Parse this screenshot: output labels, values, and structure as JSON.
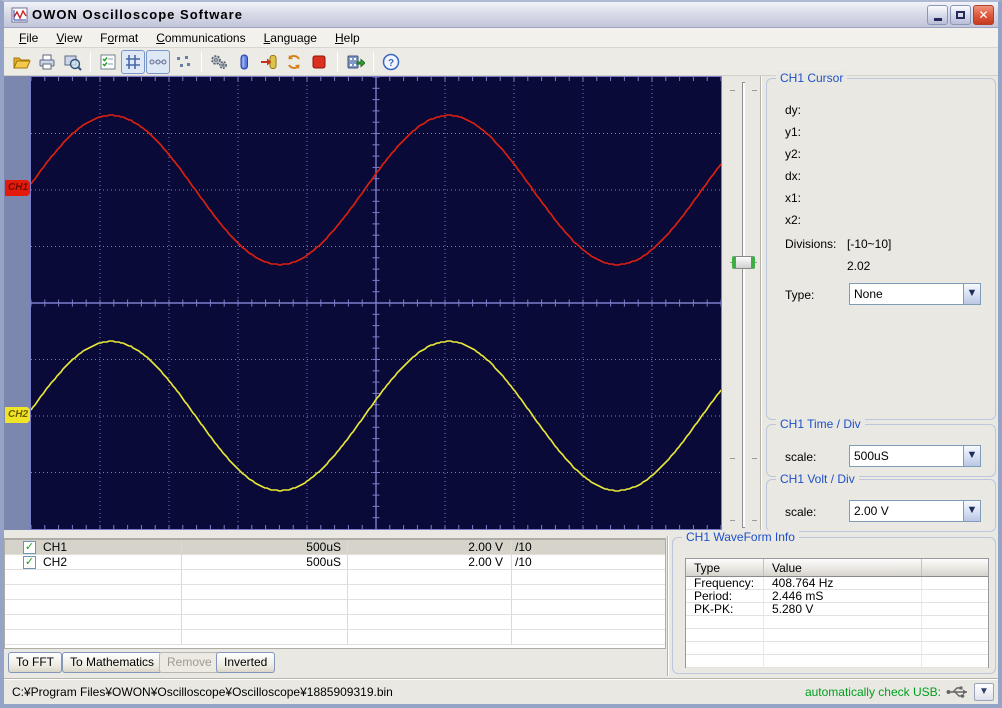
{
  "window": {
    "title": "OWON Oscilloscope Software"
  },
  "menu": {
    "items": [
      {
        "pre": "",
        "accel": "F",
        "post": "ile"
      },
      {
        "pre": "",
        "accel": "V",
        "post": "iew"
      },
      {
        "pre": "F",
        "accel": "o",
        "post": "rmat"
      },
      {
        "pre": "",
        "accel": "C",
        "post": "ommunications"
      },
      {
        "pre": "",
        "accel": "L",
        "post": "anguage"
      },
      {
        "pre": "",
        "accel": "H",
        "post": "elp"
      }
    ]
  },
  "toolbar": {
    "icons": [
      "open-folder",
      "print",
      "print-preview",
      "channel-list",
      "grid-display",
      "dot-line-display",
      "dots-display",
      "settings-gears",
      "battery",
      "exit-connect",
      "refresh",
      "stop",
      "export-record",
      "help"
    ],
    "active_icons": [
      "grid-display",
      "dot-line-display"
    ]
  },
  "plot": {
    "markers": [
      {
        "label": "CH1"
      },
      {
        "label": "CH2"
      }
    ]
  },
  "cursor_panel": {
    "title": "CH1 Cursor",
    "fields": [
      "dy:",
      "y1:",
      "y2:",
      "dx:",
      "x1:",
      "x2:"
    ],
    "divisions_label": "Divisions:",
    "divisions_value": "[-10~10]",
    "divisions_value2": "2.02",
    "type_label": "Type:",
    "type_value": "None"
  },
  "time_div": {
    "title": "CH1 Time / Div",
    "scale_label": "scale:",
    "value": "500uS"
  },
  "volt_div": {
    "title": "CH1 Volt / Div",
    "scale_label": "scale:",
    "value": "2.00 V"
  },
  "channels_table": {
    "rows": [
      {
        "name": "CH1",
        "time": "500uS",
        "volt": "2.00 V",
        "probe": "/10",
        "checked": true,
        "selected": true
      },
      {
        "name": "CH2",
        "time": "500uS",
        "volt": "2.00 V",
        "probe": "/10",
        "checked": true,
        "selected": false
      }
    ]
  },
  "action_buttons": [
    {
      "label": "To FFT",
      "enabled": true
    },
    {
      "label": "To Mathematics",
      "enabled": true
    },
    {
      "label": "Remove",
      "enabled": false
    },
    {
      "label": "Inverted",
      "enabled": true
    }
  ],
  "waveform_info": {
    "title": "CH1 WaveForm Info",
    "columns": [
      "Type",
      "Value"
    ],
    "rows": [
      [
        "Frequency:",
        "408.764 Hz"
      ],
      [
        "Period:",
        "2.446 mS"
      ],
      [
        "PK-PK:",
        "5.280 V"
      ]
    ]
  },
  "statusbar": {
    "file_path": "C:¥Program Files¥OWON¥Oscilloscope¥Oscilloscope¥1885909319.bin",
    "usb_label": "automatically check  USB:"
  },
  "colors": {
    "plot_bg": "#0a0a38",
    "grid": "#7c7cca",
    "ch1": "#dd2010",
    "ch2": "#e8e838",
    "accent_title": "#2050c8",
    "status_green": "#00a020",
    "marker_ch1": "#e41b0c",
    "marker_ch2": "#f0e428"
  },
  "chart_data": {
    "type": "line",
    "title": "Oscilloscope display CH1/CH2",
    "x_divisions": 10,
    "y_divisions": 8,
    "time_per_div": "500uS",
    "volt_per_div": "2.00 V",
    "series": [
      {
        "name": "CH1",
        "color": "#dd2010",
        "center_div": 2.0,
        "amplitude_div": 1.32,
        "period_div": 4.892,
        "phase_rad": 0.08,
        "frequency_hz": 408.764,
        "period_ms": 2.446,
        "pk_pk_v": 5.28
      },
      {
        "name": "CH2",
        "color": "#e8e838",
        "center_div": -2.0,
        "amplitude_div": 1.32,
        "period_div": 4.892,
        "phase_rad": 0.08,
        "frequency_hz": 408.764,
        "period_ms": 2.446,
        "pk_pk_v": 5.28
      }
    ]
  }
}
